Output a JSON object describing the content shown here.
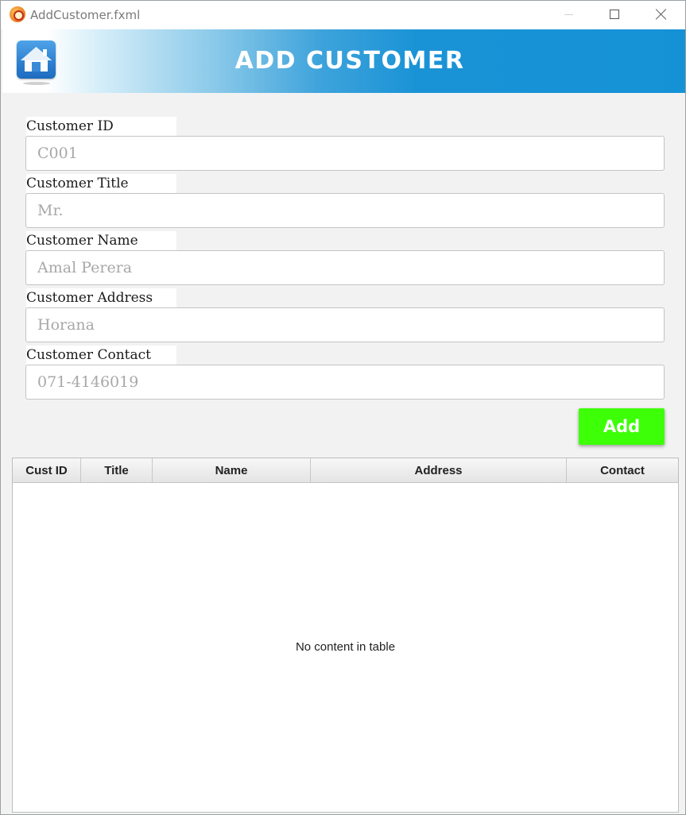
{
  "window": {
    "title": "AddCustomer.fxml"
  },
  "header": {
    "title": "ADD CUSTOMER",
    "home_icon": "home-icon"
  },
  "form": {
    "fields": [
      {
        "label": "Customer ID",
        "placeholder": "C001",
        "value": ""
      },
      {
        "label": "Customer Title",
        "placeholder": "Mr.",
        "value": ""
      },
      {
        "label": "Customer Name",
        "placeholder": "Amal Perera",
        "value": ""
      },
      {
        "label": "Customer Address",
        "placeholder": "Horana",
        "value": ""
      },
      {
        "label": "Customer Contact",
        "placeholder": "071-4146019",
        "value": ""
      }
    ],
    "add_label": "Add"
  },
  "table": {
    "columns": [
      "Cust ID",
      "Title",
      "Name",
      "Address",
      "Contact"
    ],
    "rows": [],
    "placeholder": "No content in table"
  },
  "colors": {
    "banner_blue": "#1592d6",
    "add_button": "#3dff07"
  }
}
